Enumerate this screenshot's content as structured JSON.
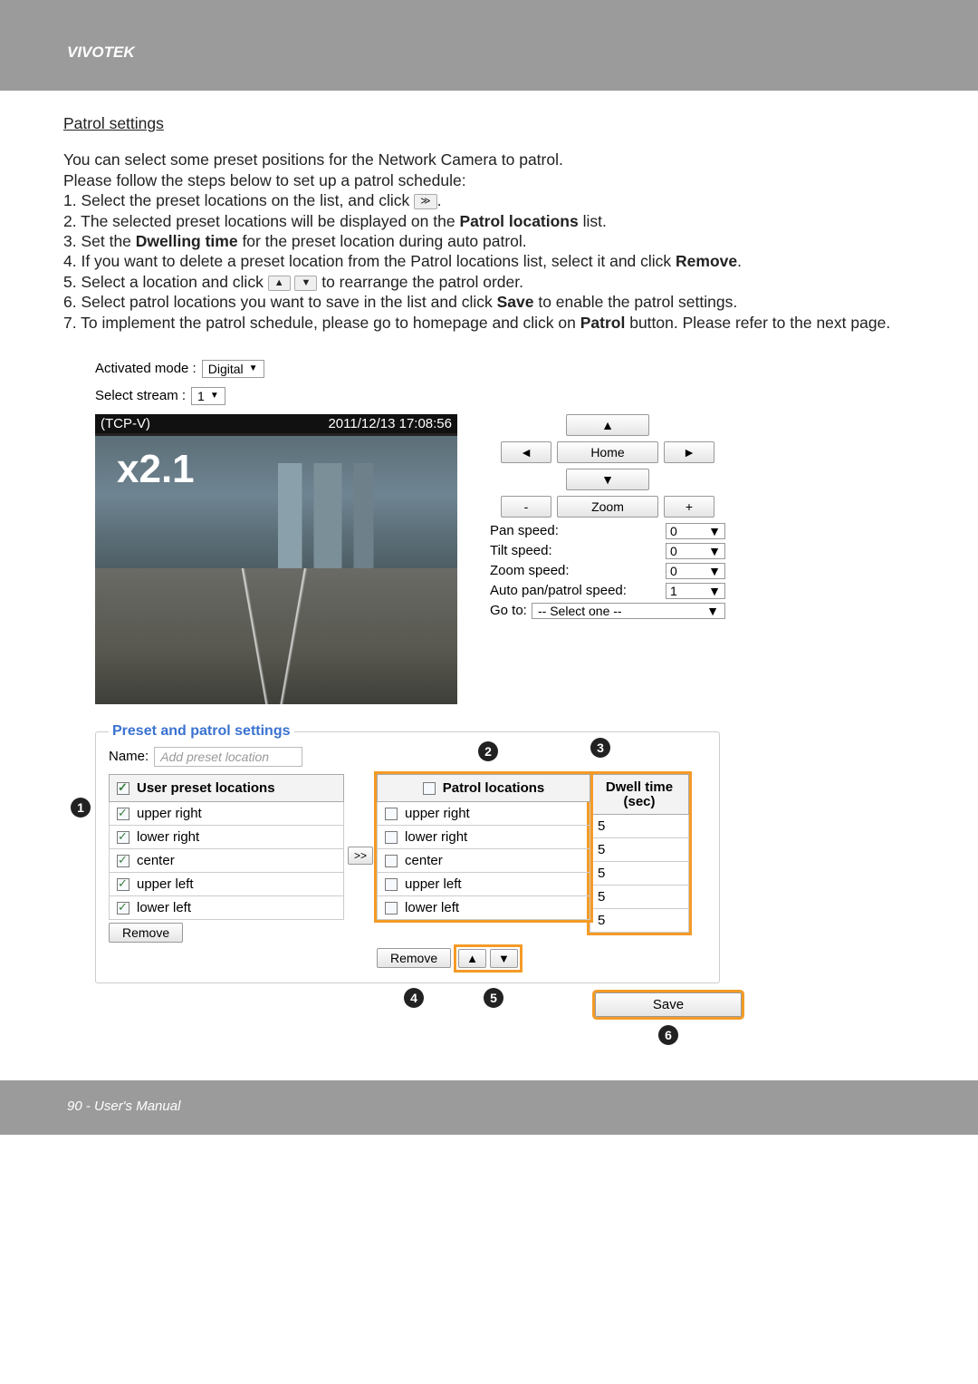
{
  "brand": "VIVOTEK",
  "section_title": "Patrol settings",
  "narrative": {
    "intro1": "You can select some preset positions for the Network Camera to patrol.",
    "intro2": "Please follow the steps below to set up a patrol schedule:",
    "step1_a": "1. Select the preset locations on the list, and click ",
    "step1_b": ".",
    "step2_a": "2. The selected preset locations will be displayed on the ",
    "step2_bold1": "Patrol locations",
    "step2_b": " list.",
    "step3_a": "3. Set the ",
    "step3_bold1": "Dwelling time",
    "step3_b": " for the preset location during auto patrol.",
    "step4_a": "4. If you want to delete a preset location from the Patrol locations list, select it and click ",
    "step4_bold1": "Remove",
    "step4_b": ".",
    "step5_a": "5. Select a location and click ",
    "step5_b": " to rearrange the patrol order.",
    "step6_a": "6. Select patrol locations you want to save in the list and click ",
    "step6_bold1": "Save",
    "step6_b": " to enable the patrol settings.",
    "step7_a": "7. To implement the patrol schedule, please go to homepage and click on ",
    "step7_bold1": "Patrol",
    "step7_b": " button. Please refer to the next page."
  },
  "ui": {
    "activated_mode_label": "Activated mode :",
    "activated_mode_value": "Digital",
    "select_stream_label": "Select stream :",
    "select_stream_value": "1",
    "video": {
      "title": "(TCP-V)",
      "timestamp": "2011/12/13  17:08:56",
      "zoom_overlay": "x2.1"
    },
    "ptz": {
      "home": "Home",
      "zoom": "Zoom",
      "pan_speed_label": "Pan speed:",
      "tilt_speed_label": "Tilt speed:",
      "zoom_speed_label": "Zoom speed:",
      "auto_speed_label": "Auto pan/patrol speed:",
      "pan_speed_value": "0",
      "tilt_speed_value": "0",
      "zoom_speed_value": "0",
      "auto_speed_value": "1",
      "goto_label": "Go to:",
      "goto_value": "-- Select one --"
    },
    "preset": {
      "legend": "Preset and patrol settings",
      "name_label": "Name:",
      "name_placeholder": "Add preset location",
      "user_header": "User preset locations",
      "patrol_header": "Patrol locations",
      "dwell_header_l1": "Dwell time",
      "dwell_header_l2": "(sec)",
      "user_items": [
        "upper right",
        "lower right",
        "center",
        "upper left",
        "lower left"
      ],
      "patrol_items": [
        "upper right",
        "lower right",
        "center",
        "upper left",
        "lower left"
      ],
      "dwell_values": [
        "5",
        "5",
        "5",
        "5",
        "5"
      ],
      "remove_label": "Remove",
      "transfer_label": ">>",
      "up_label": "▲",
      "down_label": "▼",
      "save_label": "Save"
    },
    "callouts": [
      "1",
      "2",
      "3",
      "4",
      "5",
      "6"
    ]
  },
  "footer": "90 - User's Manual"
}
